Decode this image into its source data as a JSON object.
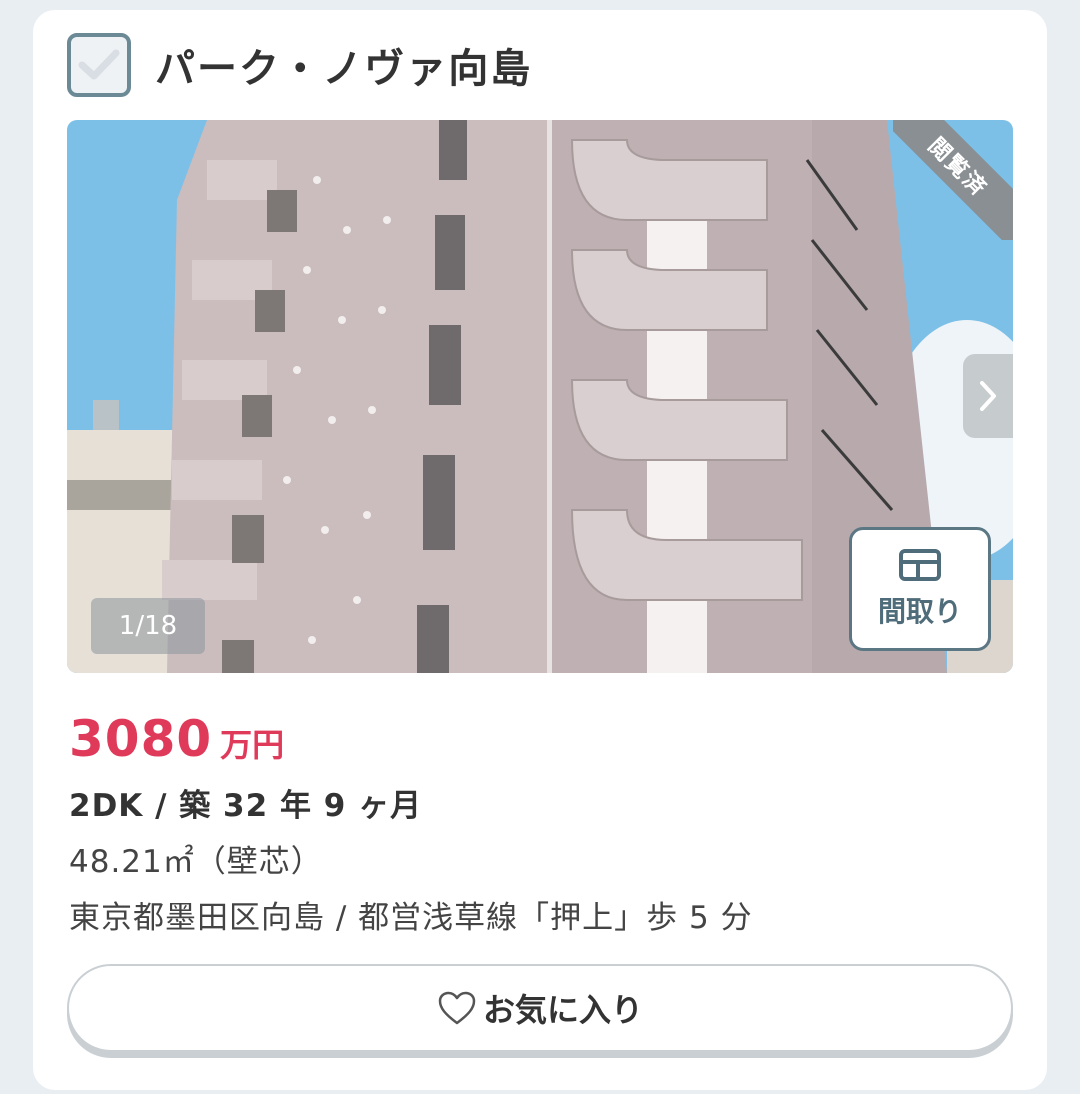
{
  "listing": {
    "title": "パーク・ノヴァ向島",
    "viewed_badge": "閲覧済",
    "photo_counter": "1/18",
    "floorplan_label": "間取り",
    "price_value": "3080",
    "price_unit": "万円",
    "spec": "2DK / 築 32 年 9 ヶ月",
    "area": "48.21㎡（壁芯）",
    "address": "東京都墨田区向島 / 都営浅草線「押上」歩 5 分",
    "favorite_label": "お気に入り"
  },
  "icons": {
    "checkbox": "check-icon",
    "next": "chevron-right-icon",
    "floorplan": "floorplan-icon",
    "favorite": "heart-outline-icon"
  },
  "colors": {
    "price": "#e03a5b",
    "accent": "#5b7784",
    "sky": "#7cc0e8"
  }
}
